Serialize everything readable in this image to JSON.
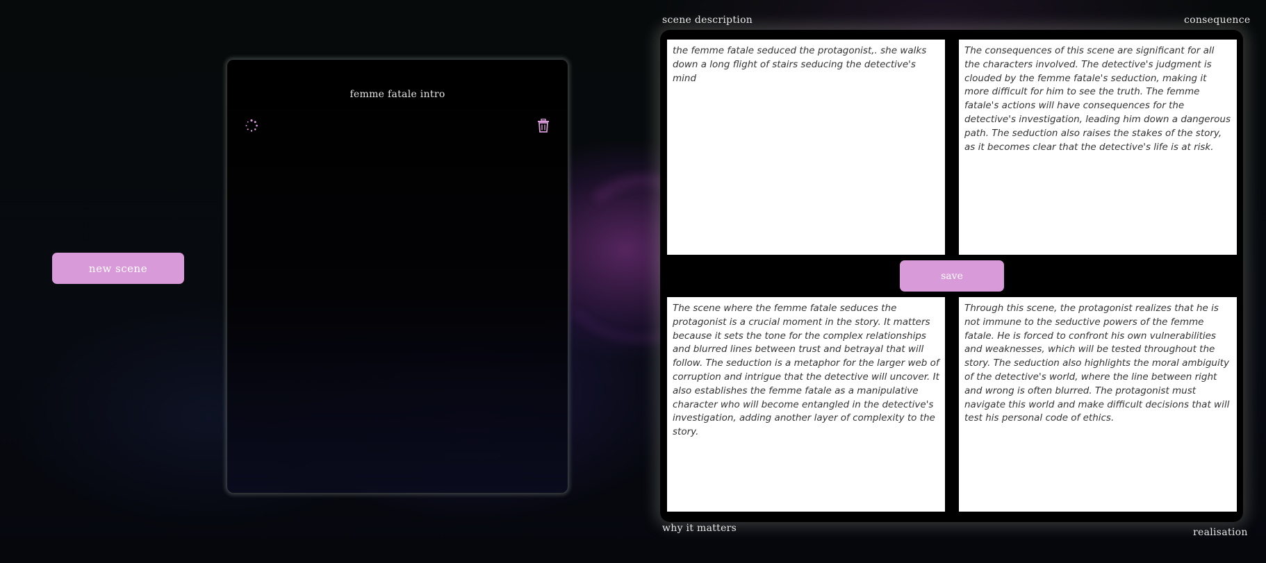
{
  "sidebar": {
    "new_scene_label": "new scene"
  },
  "scene_card": {
    "title": "femme fatale intro",
    "loading_icon": "spinner-icon",
    "delete_icon": "trash-icon"
  },
  "labels": {
    "scene_description": "scene description",
    "consequence": "consequence",
    "why_it_matters": "why it matters",
    "realisation": "realisation"
  },
  "panels": {
    "scene_description": "the femme fatale seduced the protagonist,. she walks down a long flight of stairs seducing the detective's mind",
    "consequence": "The consequences of this scene are significant for all the characters involved. The detective's judgment is clouded by the femme fatale's seduction, making it more difficult for him to see the truth. The femme fatale's actions will have consequences for the detective's investigation, leading him down a dangerous path. The seduction also raises the stakes of the story, as it becomes clear that the detective's life is at risk.",
    "why_it_matters": "The scene where the femme fatale seduces the protagonist is a crucial moment in the story. It matters because it sets the tone for the complex relationships and blurred lines between trust and betrayal that will follow. The seduction is a metaphor for the larger web of corruption and intrigue that the detective will uncover. It also establishes the femme fatale as a manipulative character who will become entangled in the detective's investigation, adding another layer of complexity to the story.",
    "realisation": "Through this scene, the protagonist realizes that he is not immune to the seductive powers of the femme fatale. He is forced to confront his own vulnerabilities and weaknesses, which will be tested throughout the story. The seduction also highlights the moral ambiguity of the detective's world, where the line between right and wrong is often blurred. The protagonist must navigate this world and make difficult decisions that will test his personal code of ethics."
  },
  "save_label": "save",
  "colors": {
    "accent": "#d89ad8",
    "background": "#050708",
    "panel": "#ffffff"
  }
}
